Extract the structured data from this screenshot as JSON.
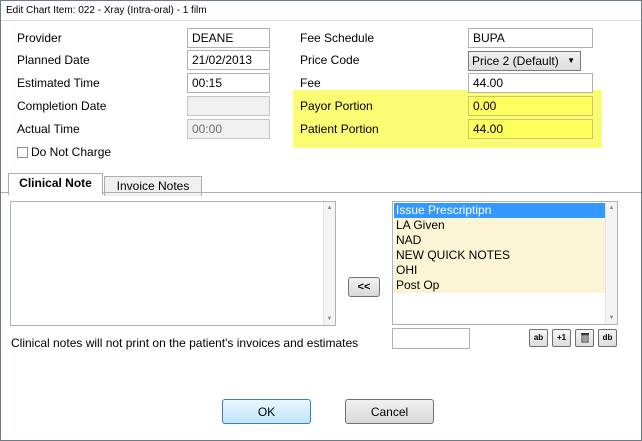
{
  "window": {
    "title": "Edit Chart Item: 022 - Xray (Intra-oral) - 1 film"
  },
  "left_fields": {
    "provider": {
      "label": "Provider",
      "value": "DEANE"
    },
    "planned_date": {
      "label": "Planned Date",
      "value": "21/02/2013"
    },
    "estimated_time": {
      "label": "Estimated Time",
      "value": "00:15"
    },
    "completion_date": {
      "label": "Completion Date",
      "value": ""
    },
    "actual_time": {
      "label": "Actual Time",
      "value": "00:00"
    },
    "do_not_charge": {
      "label": "Do Not Charge",
      "checked": false
    }
  },
  "right_fields": {
    "fee_schedule": {
      "label": "Fee Schedule",
      "value": "BUPA"
    },
    "price_code": {
      "label": "Price Code",
      "value": "Price 2 (Default)"
    },
    "fee": {
      "label": "Fee",
      "value": "44.00"
    },
    "payor_portion": {
      "label": "Payor Portion",
      "value": "0.00"
    },
    "patient_portion": {
      "label": "Patient Portion",
      "value": "44.00"
    }
  },
  "highlight_color": "#fcfc5c",
  "tabs": [
    {
      "label": "Clinical Note",
      "active": true
    },
    {
      "label": "Invoice Notes",
      "active": false
    }
  ],
  "quick_notes": {
    "items": [
      "Issue Prescriptipn",
      "LA Given",
      "NAD",
      "NEW QUICK NOTES",
      "OHI",
      "Post Op"
    ],
    "selected_index": 0,
    "insert_button": "<<",
    "tool_buttons": [
      {
        "icon": "edit-note-icon",
        "label": "ab"
      },
      {
        "icon": "add-note-icon",
        "label": "+1"
      },
      {
        "icon": "trash-icon",
        "label": ""
      },
      {
        "icon": "database-icon",
        "label": "db"
      }
    ]
  },
  "footer_note": "Clinical notes will not print on the patient's invoices and estimates",
  "buttons": {
    "ok": "OK",
    "cancel": "Cancel"
  }
}
